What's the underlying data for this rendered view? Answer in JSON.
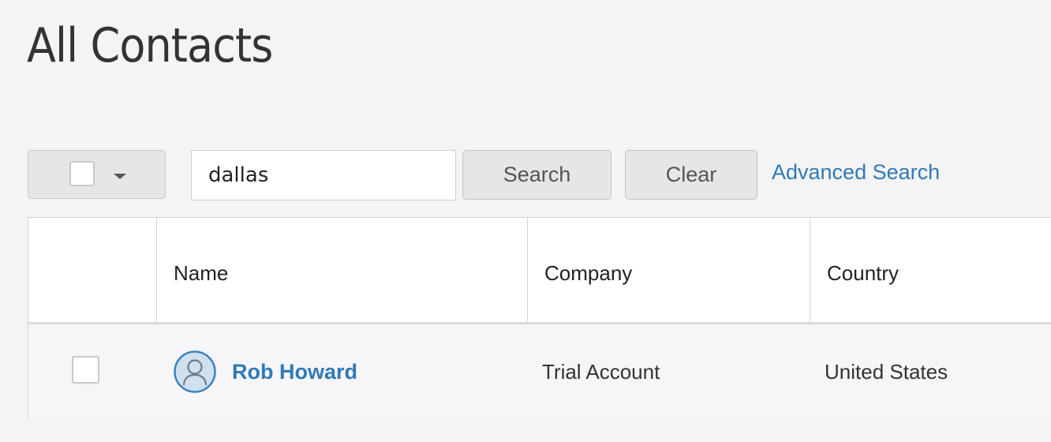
{
  "page": {
    "title": "All Contacts"
  },
  "toolbar": {
    "bulk_select_icon": "checkbox-dropdown",
    "search_value": "dallas",
    "search_label": "Search",
    "clear_label": "Clear",
    "advanced_search_label": "Advanced Search"
  },
  "table": {
    "columns": [
      "",
      "Name",
      "Company",
      "Country"
    ],
    "rows": [
      {
        "selected": false,
        "avatar_icon": "user-avatar-icon",
        "name": "Rob Howard",
        "company": "Trial Account",
        "country": "United States"
      }
    ]
  },
  "colors": {
    "link": "#2f7ab8",
    "background": "#f4f4f4",
    "button_bg": "#e6e6e6"
  }
}
